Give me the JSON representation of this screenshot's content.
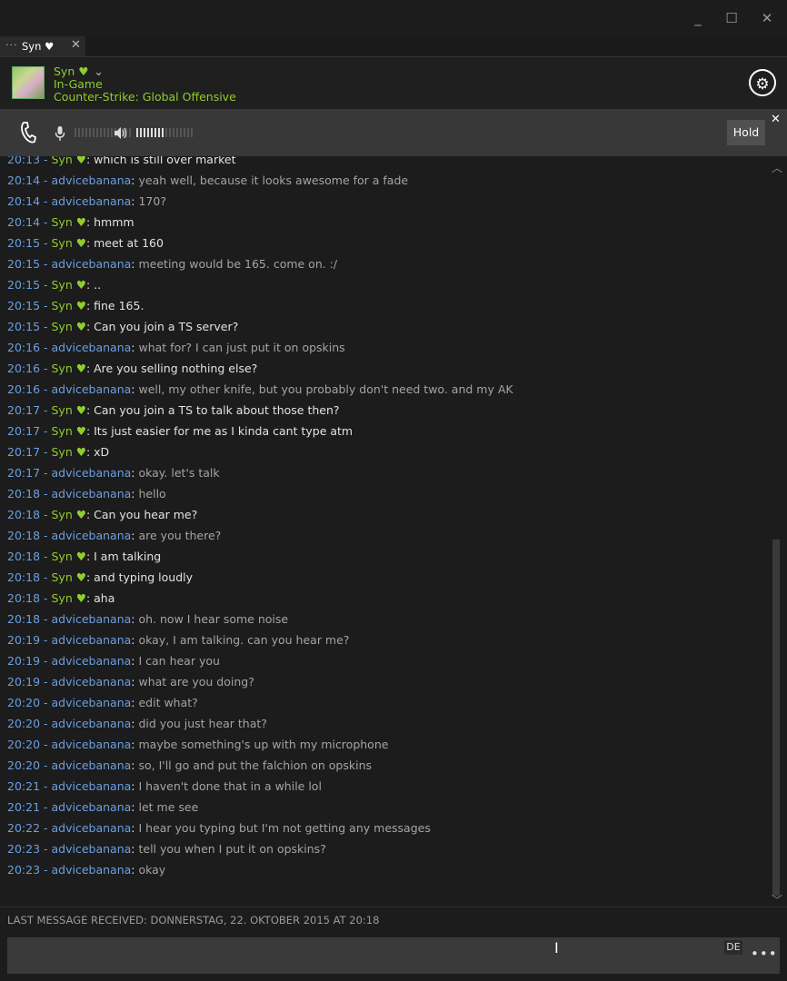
{
  "window": {
    "minimize_icon": "minimize-icon",
    "maximize_icon": "maximize-icon",
    "close_icon": "close-icon"
  },
  "tab": {
    "label": "Syn ♥",
    "menu_glyph": "···",
    "close_glyph": "✕"
  },
  "friend": {
    "name": "Syn ♥",
    "status": "In-Game",
    "game": "Counter-Strike: Global Offensive",
    "dropdown_glyph": "⌄"
  },
  "voice": {
    "hold_label": "Hold",
    "close_glyph": "✕",
    "mic_level": 0,
    "speaker_level": 0.5
  },
  "colors": {
    "friend_green": "#8fce2c",
    "user_blue": "#6b9fe0",
    "background": "#1c1c1c"
  },
  "messages": [
    {
      "time": "20:13",
      "sender": "Syn ♥",
      "text": "which is still over market"
    },
    {
      "time": "20:14",
      "sender": "advicebanana",
      "text": "yeah well, because it looks awesome for a fade"
    },
    {
      "time": "20:14",
      "sender": "advicebanana",
      "text": "170?"
    },
    {
      "time": "20:14",
      "sender": "Syn ♥",
      "text": "hmmm"
    },
    {
      "time": "20:15",
      "sender": "Syn ♥",
      "text": "meet at 160"
    },
    {
      "time": "20:15",
      "sender": "advicebanana",
      "text": "meeting would be 165. come on. :/"
    },
    {
      "time": "20:15",
      "sender": "Syn ♥",
      "text": ".."
    },
    {
      "time": "20:15",
      "sender": "Syn ♥",
      "text": "fine 165."
    },
    {
      "time": "20:15",
      "sender": "Syn ♥",
      "text": "Can you join a TS server?"
    },
    {
      "time": "20:16",
      "sender": "advicebanana",
      "text": "what for? I can just put it on opskins"
    },
    {
      "time": "20:16",
      "sender": "Syn ♥",
      "text": "Are you selling nothing else?"
    },
    {
      "time": "20:16",
      "sender": "advicebanana",
      "text": "well, my other knife, but you probably don't need two. and my AK"
    },
    {
      "time": "20:17",
      "sender": "Syn ♥",
      "text": "Can you join a TS to talk about those then?"
    },
    {
      "time": "20:17",
      "sender": "Syn ♥",
      "text": "Its just easier for me as I kinda cant type atm"
    },
    {
      "time": "20:17",
      "sender": "Syn ♥",
      "text": "xD"
    },
    {
      "time": "20:17",
      "sender": "advicebanana",
      "text": "okay. let's talk"
    },
    {
      "time": "20:18",
      "sender": "advicebanana",
      "text": "hello"
    },
    {
      "time": "20:18",
      "sender": "Syn ♥",
      "text": "Can you hear me?"
    },
    {
      "time": "20:18",
      "sender": "advicebanana",
      "text": "are you there?"
    },
    {
      "time": "20:18",
      "sender": "Syn ♥",
      "text": "I am talking"
    },
    {
      "time": "20:18",
      "sender": "Syn ♥",
      "text": "and typing loudly"
    },
    {
      "time": "20:18",
      "sender": "Syn ♥",
      "text": "aha"
    },
    {
      "time": "20:18",
      "sender": "advicebanana",
      "text": "oh. now I hear some noise"
    },
    {
      "time": "20:19",
      "sender": "advicebanana",
      "text": "okay, I am talking. can you hear me?"
    },
    {
      "time": "20:19",
      "sender": "advicebanana",
      "text": "I can hear you"
    },
    {
      "time": "20:19",
      "sender": "advicebanana",
      "text": "what are you doing?"
    },
    {
      "time": "20:20",
      "sender": "advicebanana",
      "text": "edit what?"
    },
    {
      "time": "20:20",
      "sender": "advicebanana",
      "text": "did you just hear that?"
    },
    {
      "time": "20:20",
      "sender": "advicebanana",
      "text": "maybe something's up with my microphone"
    },
    {
      "time": "20:20",
      "sender": "advicebanana",
      "text": "so, I'll go and put the falchion on opskins"
    },
    {
      "time": "20:21",
      "sender": "advicebanana",
      "text": "I haven't done that in a while lol"
    },
    {
      "time": "20:21",
      "sender": "advicebanana",
      "text": "let me see"
    },
    {
      "time": "20:22",
      "sender": "advicebanana",
      "text": "I hear you typing but I'm not getting any messages"
    },
    {
      "time": "20:23",
      "sender": "advicebanana",
      "text": "tell you when I put it on opskins?"
    },
    {
      "time": "20:23",
      "sender": "advicebanana",
      "text": "okay"
    }
  ],
  "status_text": "LAST MESSAGE RECEIVED: DONNERSTAG, 22. OKTOBER 2015 AT 20:18",
  "input": {
    "value": "",
    "placeholder": "",
    "lang_label": "DE",
    "more_glyph": "•••"
  }
}
